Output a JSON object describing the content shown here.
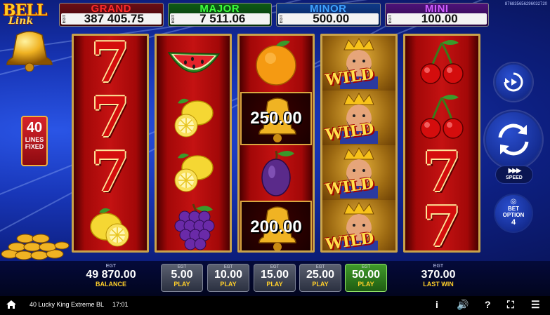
{
  "jackpots": [
    {
      "name": "GRAND",
      "egt": "EGT",
      "value": "387 405.75"
    },
    {
      "name": "MAJOR",
      "egt": "EGT",
      "value": "7 511.06"
    },
    {
      "name": "MINOR",
      "egt": "EGT",
      "value": "500.00"
    },
    {
      "name": "MINI",
      "egt": "EGT",
      "value": "100.00"
    }
  ],
  "ticket_id": "876835656296032720",
  "logo": {
    "line1": "BELL",
    "line2": "Link"
  },
  "lines": {
    "count": "40",
    "label1": "LINES",
    "label2": "FIXED"
  },
  "reels": [
    [
      "seven",
      "seven",
      "seven",
      "lemon"
    ],
    [
      "watermelon",
      "lemon",
      "lemon",
      "grapes"
    ],
    [
      "orange",
      "bell",
      "plum",
      "bell"
    ],
    [
      "wild",
      "wild",
      "wild",
      "wild"
    ],
    [
      "cherry",
      "cherry",
      "seven",
      "seven"
    ]
  ],
  "bell_values": {
    "reel3_row2": "250.00",
    "reel3_row4": "200.00"
  },
  "wild_label": "WILD",
  "controls": {
    "speed_label": "SPEED",
    "bet_option_label1": "BET",
    "bet_option_label2": "OPTION",
    "bet_option_value": "4"
  },
  "balance": {
    "egt": "EGT",
    "value": "49 870.00",
    "label": "BALANCE"
  },
  "bets": [
    {
      "egt": "EGT",
      "value": "5.00",
      "label": "PLAY",
      "active": false
    },
    {
      "egt": "EGT",
      "value": "10.00",
      "label": "PLAY",
      "active": false
    },
    {
      "egt": "EGT",
      "value": "15.00",
      "label": "PLAY",
      "active": false
    },
    {
      "egt": "EGT",
      "value": "25.00",
      "label": "PLAY",
      "active": false
    },
    {
      "egt": "EGT",
      "value": "50.00",
      "label": "PLAY",
      "active": true
    }
  ],
  "last_win": {
    "egt": "EGT",
    "value": "370.00",
    "label": "LAST WIN"
  },
  "footer": {
    "game_name": "40 Lucky King Extreme BL",
    "clock": "17:01",
    "info_glyph": "i",
    "sound_glyph": "🔊",
    "help_glyph": "?",
    "fullscreen_glyph": "⛶",
    "menu_glyph": "☰"
  },
  "icons": {
    "home": "home-icon",
    "autoplay": "autoplay-icon",
    "spin": "spin-icon",
    "speed": "speed-icon",
    "coins": "coins-icon"
  },
  "colors": {
    "grand": "#ff2a2a",
    "major": "#3cff3c",
    "minor": "#3ea2ff",
    "mini": "#d05cff",
    "accent_gold": "#ffcf2a",
    "active_bet": "#3f9a2a"
  }
}
